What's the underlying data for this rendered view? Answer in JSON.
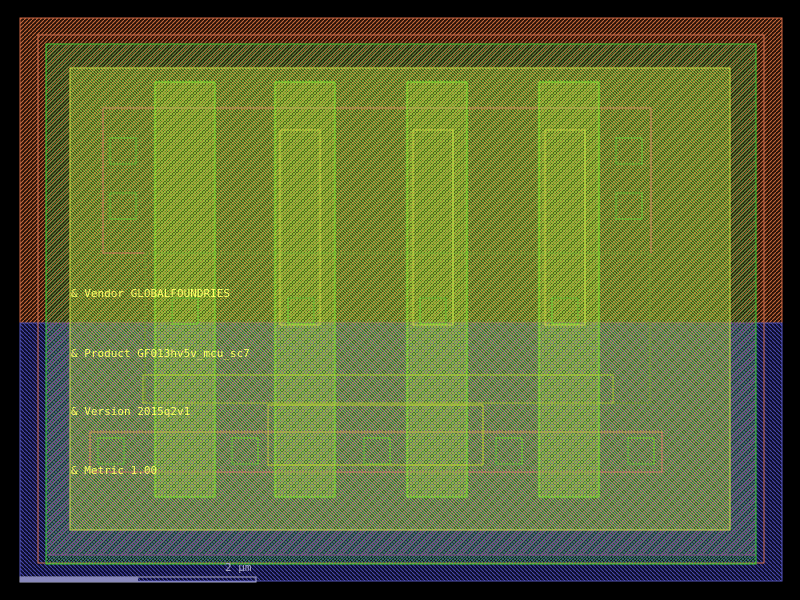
{
  "layout_text": {
    "vendor": "& Vendor GLOBALFOUNDRIES",
    "product": "& Product GF013hv5v_mcu_sc7",
    "version": "& Version 2015q2v1",
    "metric": "& Metric 1.00"
  },
  "scale_bar": {
    "label": "2 µm"
  },
  "colors": {
    "background": "#000000",
    "text": "#ffff66",
    "nwell": "#cc6644",
    "pwell": "#5555bb",
    "comp": "#33cc33",
    "poly": "#88ee33",
    "metal": "#ccdd44",
    "contact": "#66bb33",
    "implant": "#aa33bb",
    "scale": "#aaaacc"
  }
}
